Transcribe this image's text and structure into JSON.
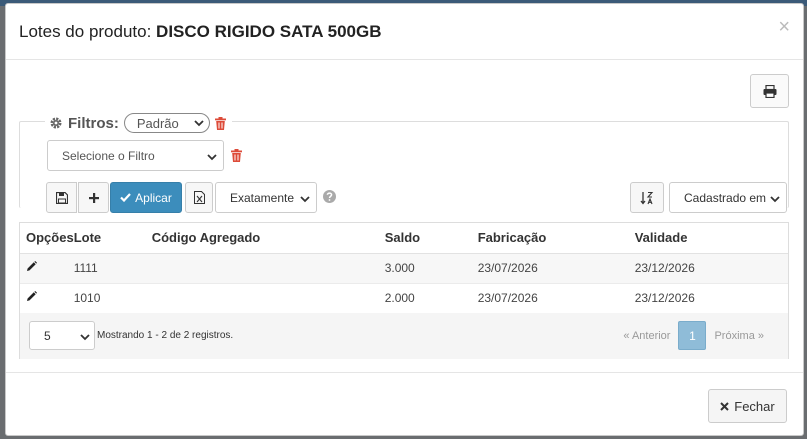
{
  "modal": {
    "title_prefix": "Lotes do produto: ",
    "product_name": "DISCO RIGIDO SATA 500GB",
    "close_glyph": "×"
  },
  "filters": {
    "legend_label": "Filtros:",
    "preset_value": "Padrão",
    "filter_select_placeholder": "Selecione o Filtro",
    "apply_label": "Aplicar",
    "match_mode_value": "Exatamente",
    "sort_value": "Cadastrado em"
  },
  "table": {
    "columns": [
      "Opções",
      "Lote",
      "Código Agregado",
      "Saldo",
      "Fabricação",
      "Validade"
    ],
    "rows": [
      {
        "lote": "1111",
        "codigo_agregado": "",
        "saldo": "3.000",
        "fabricacao": "23/07/2026",
        "validade": "23/12/2026"
      },
      {
        "lote": "1010",
        "codigo_agregado": "",
        "saldo": "2.000",
        "fabricacao": "23/07/2026",
        "validade": "23/12/2026"
      }
    ]
  },
  "pagination": {
    "page_size": "5",
    "summary": "Mostrando 1 - 2 de 2 registros.",
    "prev_label": "« Anterior",
    "current_page": "1",
    "next_label": "Próxima »"
  },
  "footer": {
    "close_label": "Fechar"
  },
  "colors": {
    "primary": "#3c8dbc",
    "danger": "#dd4b39",
    "active_page": "#8fbcd8"
  },
  "icons": [
    "print-icon",
    "gear-icon",
    "trash-icon",
    "save-icon",
    "plus-icon",
    "check-icon",
    "excel-icon",
    "question-icon",
    "sort-alpha-icon",
    "pencil-icon",
    "times-icon",
    "chevron-down-icon"
  ]
}
